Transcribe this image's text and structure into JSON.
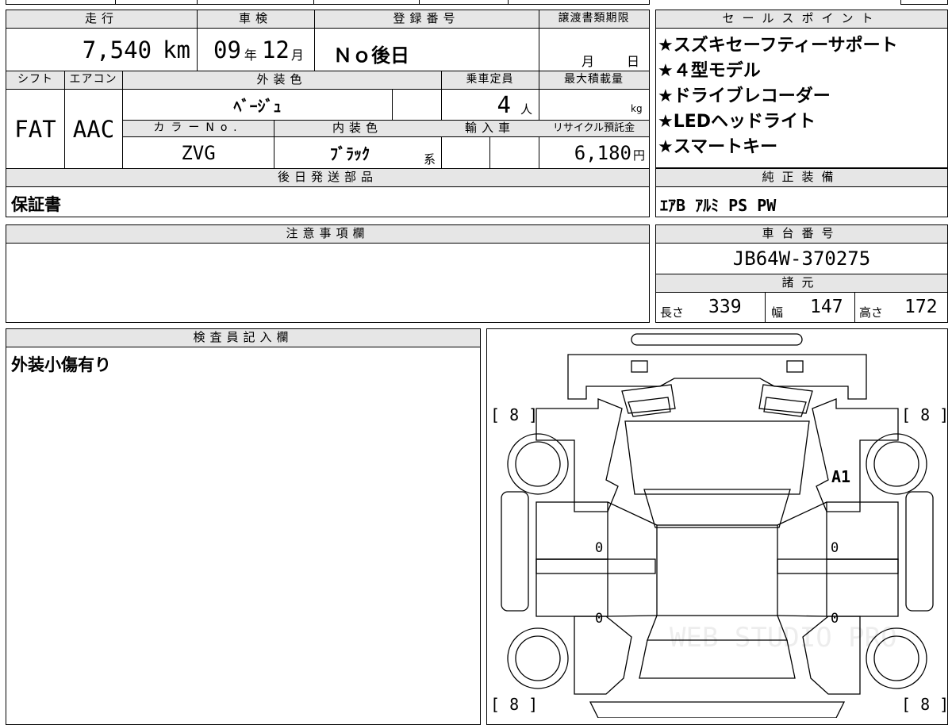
{
  "mileage": {
    "header": "走行",
    "value": "7,540",
    "unit": "km"
  },
  "inspection": {
    "header": "車検",
    "year": "09",
    "year_unit": "年",
    "month": "12",
    "month_unit": "月"
  },
  "registration": {
    "header": "登録番号",
    "value": "Ｎｏ後日"
  },
  "transfer_deadline": {
    "header": "譲渡書類期限",
    "month_unit": "月",
    "day_unit": "日"
  },
  "sales_points": {
    "header": "セールスポイント",
    "items": [
      "★スズキセーフティーサポート",
      "★４型モデル",
      "★ドライブレコーダー",
      "★LEDヘッドライト",
      "★スマートキー"
    ]
  },
  "shift": {
    "header": "シフト",
    "value": "FAT"
  },
  "aircon": {
    "header": "エアコン",
    "value": "AAC"
  },
  "exterior_color": {
    "header": "外装色",
    "value": "ﾍﾞｰｼﾞｭ"
  },
  "capacity": {
    "header": "乗車定員",
    "value": "4",
    "unit": "人"
  },
  "max_load": {
    "header": "最大積載量",
    "unit": "kg"
  },
  "color_no": {
    "header": "カラーNo.",
    "value": "ZVG"
  },
  "interior_color": {
    "header": "内装色",
    "value": "ﾌﾞﾗｯｸ",
    "suffix": "系"
  },
  "imported": {
    "header": "輸入車"
  },
  "recycle_fee": {
    "header": "リサイクル預託金",
    "value": "6,180",
    "unit": "円"
  },
  "later_parts": {
    "header": "後日発送部品",
    "value": "保証書"
  },
  "standard_equipment": {
    "header": "純正装備",
    "value": "ｴｱB ｱﾙﾐ PS PW"
  },
  "notes": {
    "header": "注意事項欄",
    "value": ""
  },
  "chassis_number": {
    "header": "車台番号",
    "value": "JB64W-370275"
  },
  "specs": {
    "header": "諸元",
    "length_label": "長さ",
    "length": "339",
    "width_label": "幅",
    "width": "147",
    "height_label": "高さ",
    "height": "172"
  },
  "inspector": {
    "header": "検査員記入欄",
    "value": "外装小傷有り"
  },
  "diagram": {
    "tire_fl": "[ 8 ]",
    "tire_fr": "[ 8 ]",
    "tire_rl": "[ 8 ]",
    "tire_rr": "[ 8 ]",
    "damage_mark": "A1",
    "door_fl": "0",
    "door_fr": "0",
    "door_rl": "0",
    "door_rr": "0",
    "watermark": "WEB STUDIO PRO"
  }
}
